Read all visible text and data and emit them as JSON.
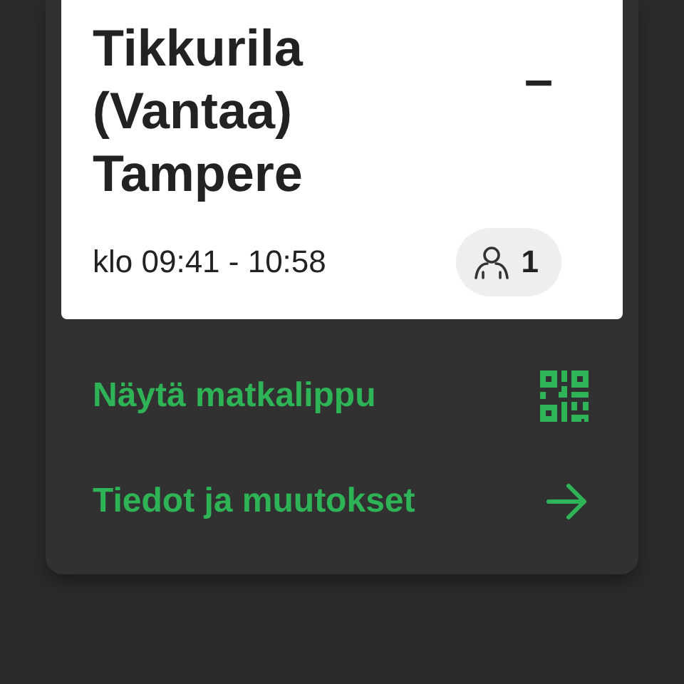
{
  "journey": {
    "from": "Tikkurila (Vantaa)",
    "separator": "–",
    "to": "Tampere",
    "time": "klo 09:41 - 10:58",
    "passengers": "1"
  },
  "actions": [
    {
      "label": "Näytä matkalippu",
      "kind": "qr"
    },
    {
      "label": "Tiedot ja muutokset",
      "kind": "arrow"
    }
  ]
}
